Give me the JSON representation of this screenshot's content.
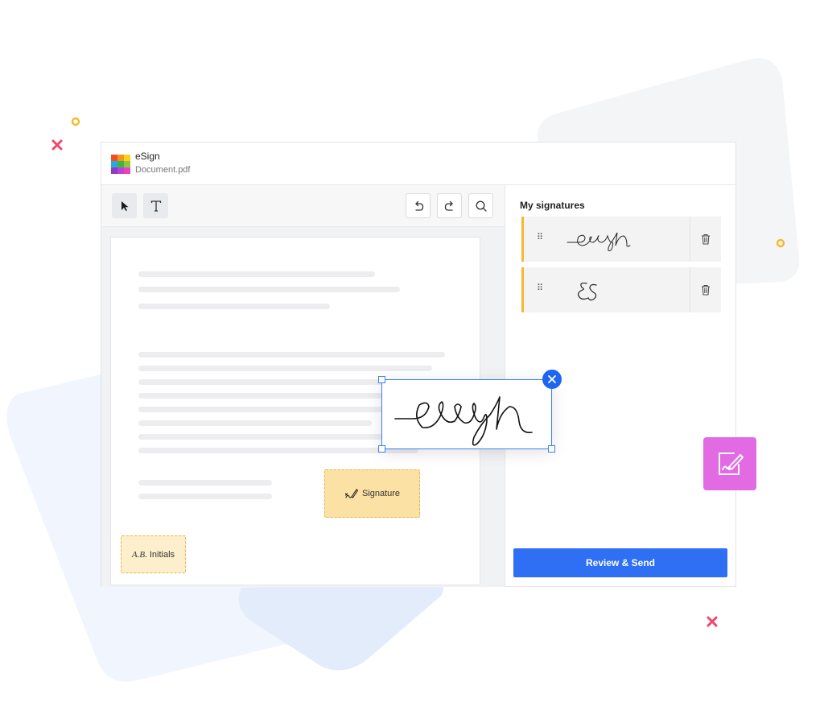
{
  "app": {
    "name": "eSign",
    "file_name": "Document.pdf"
  },
  "toolbar": {
    "select_tool_icon": "cursor-arrow-icon",
    "text_tool_icon": "text-t-icon",
    "undo_icon": "undo-icon",
    "redo_icon": "redo-icon",
    "search_icon": "search-icon"
  },
  "document": {
    "signature_field_label": "Signature",
    "signature_field_icon": "pen-icon",
    "initials_prefix": "A.B.",
    "initials_label": "Initials"
  },
  "sidebar": {
    "title": "My signatures",
    "signatures": [
      {
        "icon": "handwritten-signature"
      },
      {
        "icon": "handwritten-initials"
      }
    ],
    "review_button": "Review & Send"
  },
  "colors": {
    "primary_blue": "#2f6ff3",
    "field_yellow": "#fbe1a3",
    "card_accent": "#f5b92b",
    "badge_pink": "#e26be4",
    "decoration_red": "#f0476a",
    "decoration_yellow": "#f5b92b"
  }
}
